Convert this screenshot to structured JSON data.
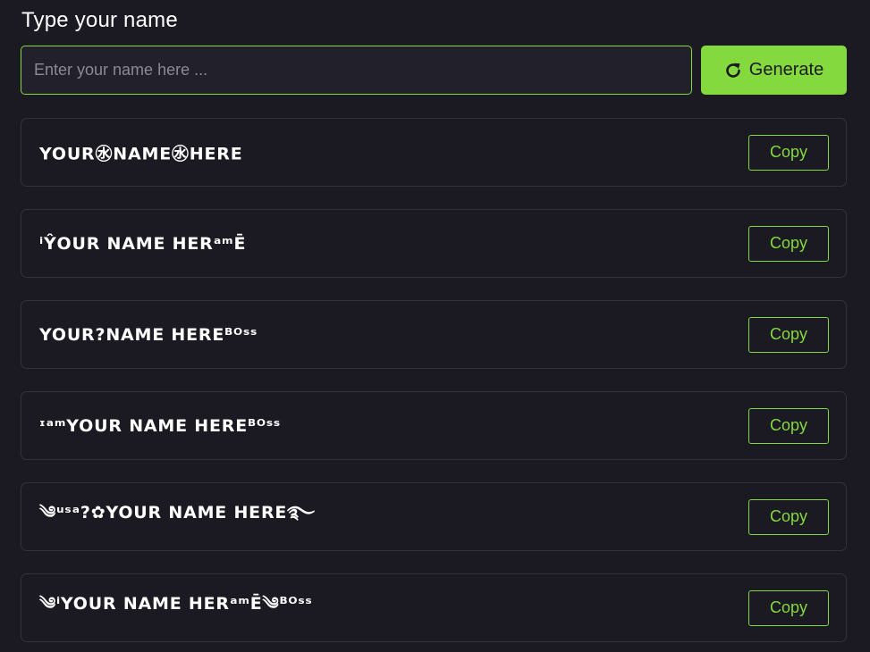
{
  "heading": "Type your name",
  "input": {
    "placeholder": "Enter your name here ...",
    "value": ""
  },
  "generate_button": {
    "label": "Generate",
    "icon": "refresh-icon"
  },
  "results": [
    {
      "text": "YOUR㊌NAME㊌HERE",
      "copy_label": "Copy"
    },
    {
      "text": "ⁱŶOUR NAME HERᵃᵐĒ",
      "copy_label": "Copy"
    },
    {
      "text": "YOUR?NAME HEREᴮᴼˢˢ",
      "copy_label": "Copy"
    },
    {
      "text": "ᶦᵃᵐYOUR NAME HEREᴮᴼˢˢ",
      "copy_label": "Copy"
    },
    {
      "text": "༄ᵘˢᵃ?✿YOUR NAME HERE࿐",
      "copy_label": "Copy"
    },
    {
      "text": "༄ⁱYOUR NAME HERᵃᵐĒ༄ᴮᴼˢˢ",
      "copy_label": "Copy"
    }
  ],
  "colors": {
    "background": "#1b1a22",
    "accent": "#84d93f",
    "card_border": "#34333d",
    "input_background": "#22212b"
  }
}
